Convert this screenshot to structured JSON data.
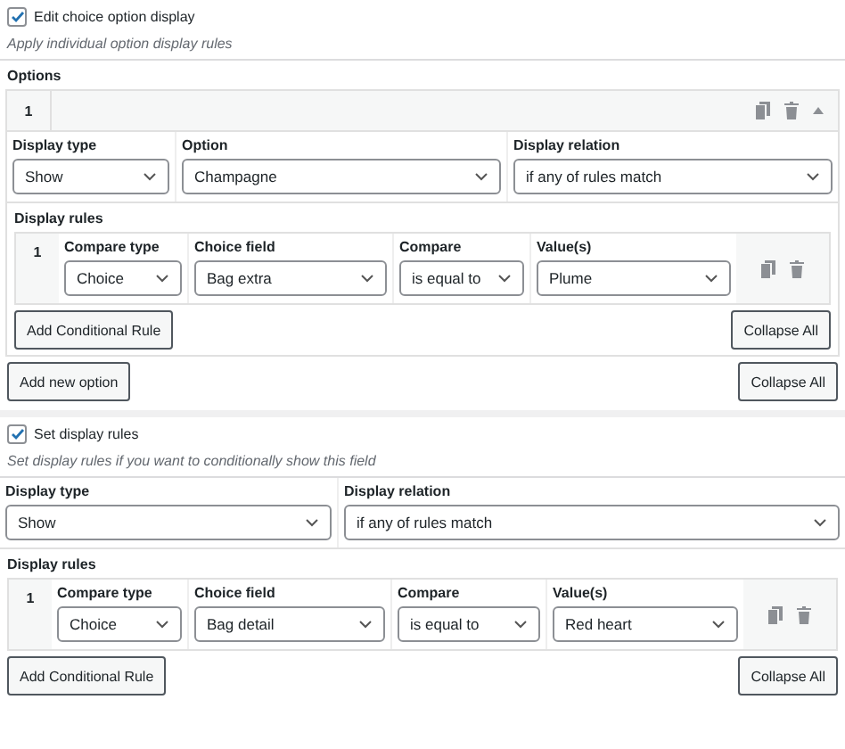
{
  "option_display": {
    "checkbox": {
      "label": "Edit choice option display",
      "checked": true
    },
    "hint": "Apply individual option display rules",
    "options_label": "Options",
    "options": [
      {
        "index": "1",
        "expanded": true,
        "fields": [
          {
            "label": "Display type",
            "value": "Show"
          },
          {
            "label": "Option",
            "value": "Champagne"
          },
          {
            "label": "Display relation",
            "value": "if any of rules match"
          }
        ],
        "rules_label": "Display rules",
        "rules": [
          {
            "index": "1",
            "fields": [
              {
                "label": "Compare type",
                "value": "Choice"
              },
              {
                "label": "Choice field",
                "value": "Bag extra"
              },
              {
                "label": "Compare",
                "value": "is equal to"
              },
              {
                "label": "Value(s)",
                "value": "Plume"
              }
            ]
          }
        ],
        "add_rule_button": "Add Conditional Rule",
        "collapse_button": "Collapse All"
      }
    ],
    "add_option_button": "Add new option",
    "collapse_button": "Collapse All"
  },
  "field_display": {
    "checkbox": {
      "label": "Set display rules",
      "checked": true
    },
    "hint": "Set display rules if you want to conditionally show this field",
    "fields": [
      {
        "label": "Display type",
        "value": "Show"
      },
      {
        "label": "Display relation",
        "value": "if any of rules match"
      }
    ],
    "rules_label": "Display rules",
    "rules": [
      {
        "index": "1",
        "fields": [
          {
            "label": "Compare type",
            "value": "Choice"
          },
          {
            "label": "Choice field",
            "value": "Bag detail"
          },
          {
            "label": "Compare",
            "value": "is equal to"
          },
          {
            "label": "Value(s)",
            "value": "Red heart"
          }
        ]
      }
    ],
    "add_rule_button": "Add Conditional Rule",
    "collapse_button": "Collapse All"
  }
}
